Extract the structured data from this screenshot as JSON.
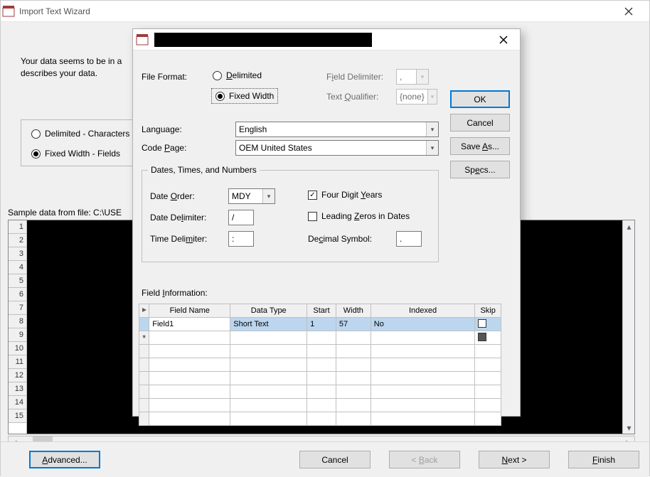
{
  "outer": {
    "title": "Import Text Wizard",
    "intro1": "Your data seems to be in a",
    "intro2": "describes your data.",
    "radio_delimited": "Delimited - Characters",
    "radio_fixed": "Fixed Width - Fields",
    "sample_label": "Sample data from file:  C:\\USE",
    "rownums": [
      "1",
      "2",
      "3",
      "4",
      "5",
      "6",
      "7",
      "8",
      "9",
      "10",
      "11",
      "12",
      "13",
      "14",
      "15"
    ],
    "buttons": {
      "advanced": "Advanced...",
      "cancel": "Cancel",
      "back": "<  Back",
      "next": "Next  >",
      "finish": "Finish"
    }
  },
  "inner": {
    "labels": {
      "file_format": "File Format:",
      "delimited": "Delimited",
      "fixed_width": "Fixed Width",
      "field_delim": "Field Delimiter:",
      "text_qual": "Text Qualifier:",
      "language": "Language:",
      "code_page": "Code Page:",
      "group_title": "Dates, Times, and Numbers",
      "date_order": "Date Order:",
      "date_delim": "Date Delimiter:",
      "time_delim": "Time Delimiter:",
      "four_digit": "Four Digit Years",
      "leading_zeros": "Leading Zeros in Dates",
      "decimal_symbol": "Decimal Symbol:",
      "field_info": "Field Information:"
    },
    "values": {
      "field_delim": ",",
      "text_qual": "{none}",
      "language": "English",
      "code_page": "OEM United States",
      "date_order": "MDY",
      "date_delim": "/",
      "time_delim": ":",
      "decimal_symbol": "."
    },
    "sidebtns": {
      "ok": "OK",
      "cancel": "Cancel",
      "save_as": "Save As...",
      "specs": "Specs..."
    },
    "grid": {
      "headers": {
        "field_name": "Field Name",
        "data_type": "Data Type",
        "start": "Start",
        "width": "Width",
        "indexed": "Indexed",
        "skip": "Skip"
      },
      "rows": [
        {
          "field_name": "Field1",
          "data_type": "Short Text",
          "start": "1",
          "width": "57",
          "indexed": "No",
          "skip": false
        }
      ]
    }
  }
}
